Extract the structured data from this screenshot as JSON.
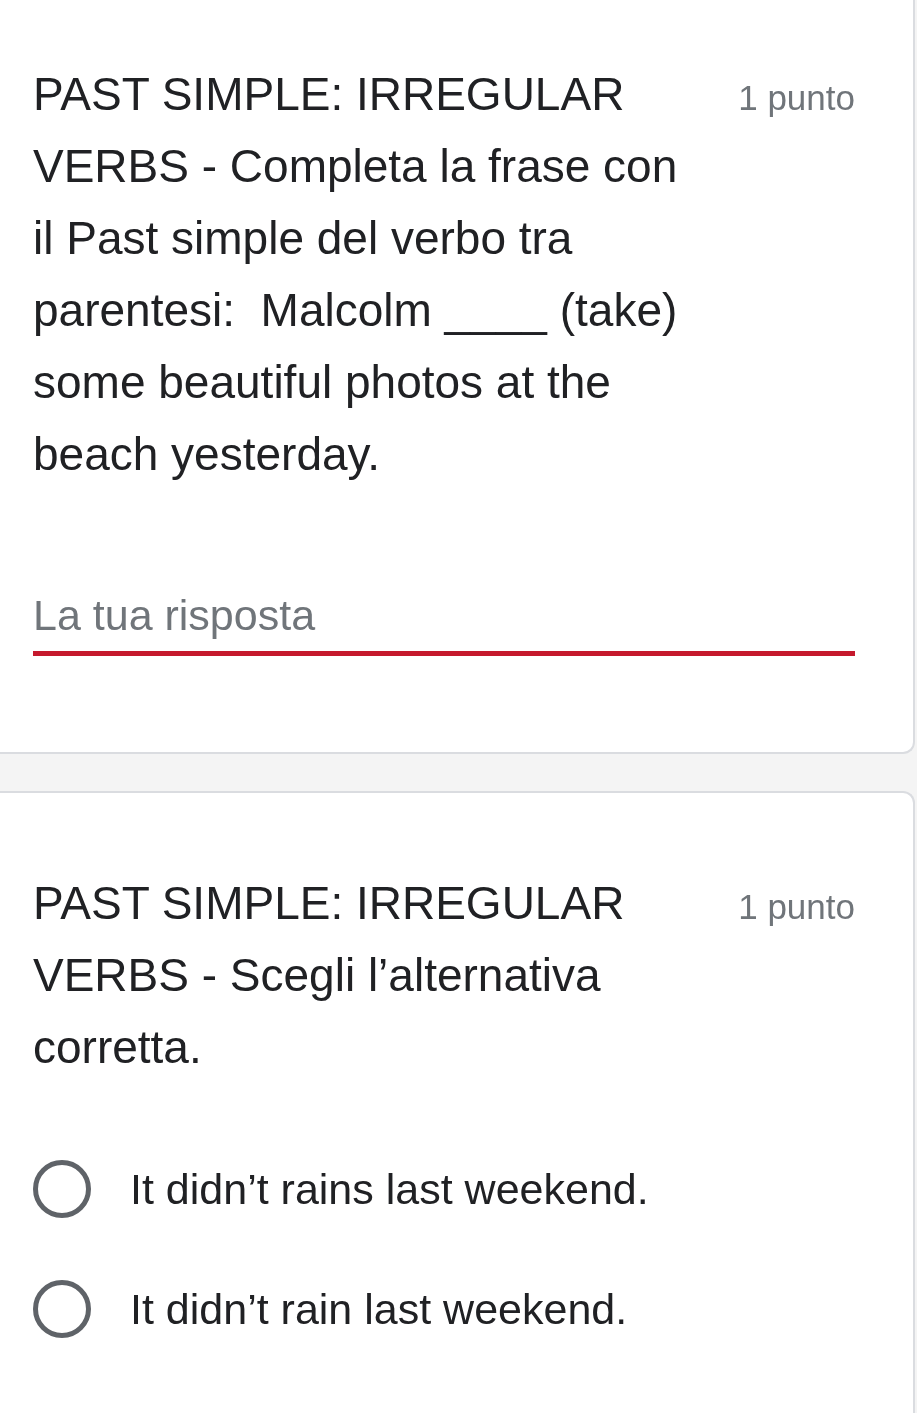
{
  "questions": [
    {
      "kind": "short_answer",
      "title": "PAST SIMPLE: IRREGULAR VERBS - Completa la frase con il Past simple del verbo tra parentesi:  Malcolm ____ (take) some beautiful photos at the beach yesterday.",
      "points": "1 punto",
      "answer": {
        "placeholder": "La tua risposta"
      }
    },
    {
      "kind": "multiple_choice",
      "title": "PAST SIMPLE: IRREGULAR VERBS - Scegli l’alternativa corretta.",
      "points": "1 punto",
      "options": [
        {
          "label": "It didn’t rains last weekend.",
          "selected": false
        },
        {
          "label": "It didn’t rain last weekend.",
          "selected": false
        }
      ]
    }
  ]
}
